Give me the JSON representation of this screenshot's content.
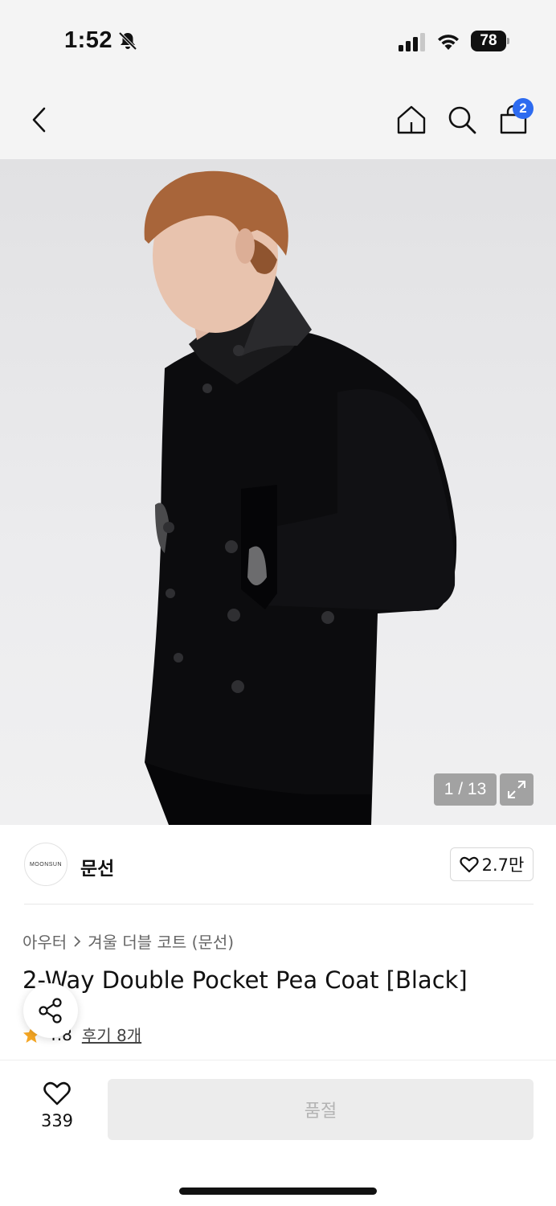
{
  "status_bar": {
    "time": "1:52",
    "battery": "78"
  },
  "nav": {
    "cart_count": "2"
  },
  "gallery": {
    "counter": "1 / 13"
  },
  "brand": {
    "logo_text": "MOONSUN",
    "name": "문선",
    "likes": "2.7만"
  },
  "breadcrumb": {
    "category": "아우터",
    "subcategory": "겨울 더블 코트 (문선)"
  },
  "product": {
    "title": "2-Way Double Pocket Pea Coat [Black]",
    "rating": "4.8",
    "reviews": "후기 8개"
  },
  "bottom_bar": {
    "wish_count": "339",
    "soldout_label": "품절"
  },
  "colors": {
    "accent": "#2d6bf0",
    "star": "#f5a623",
    "nav_bg": "#f4f4f4"
  }
}
